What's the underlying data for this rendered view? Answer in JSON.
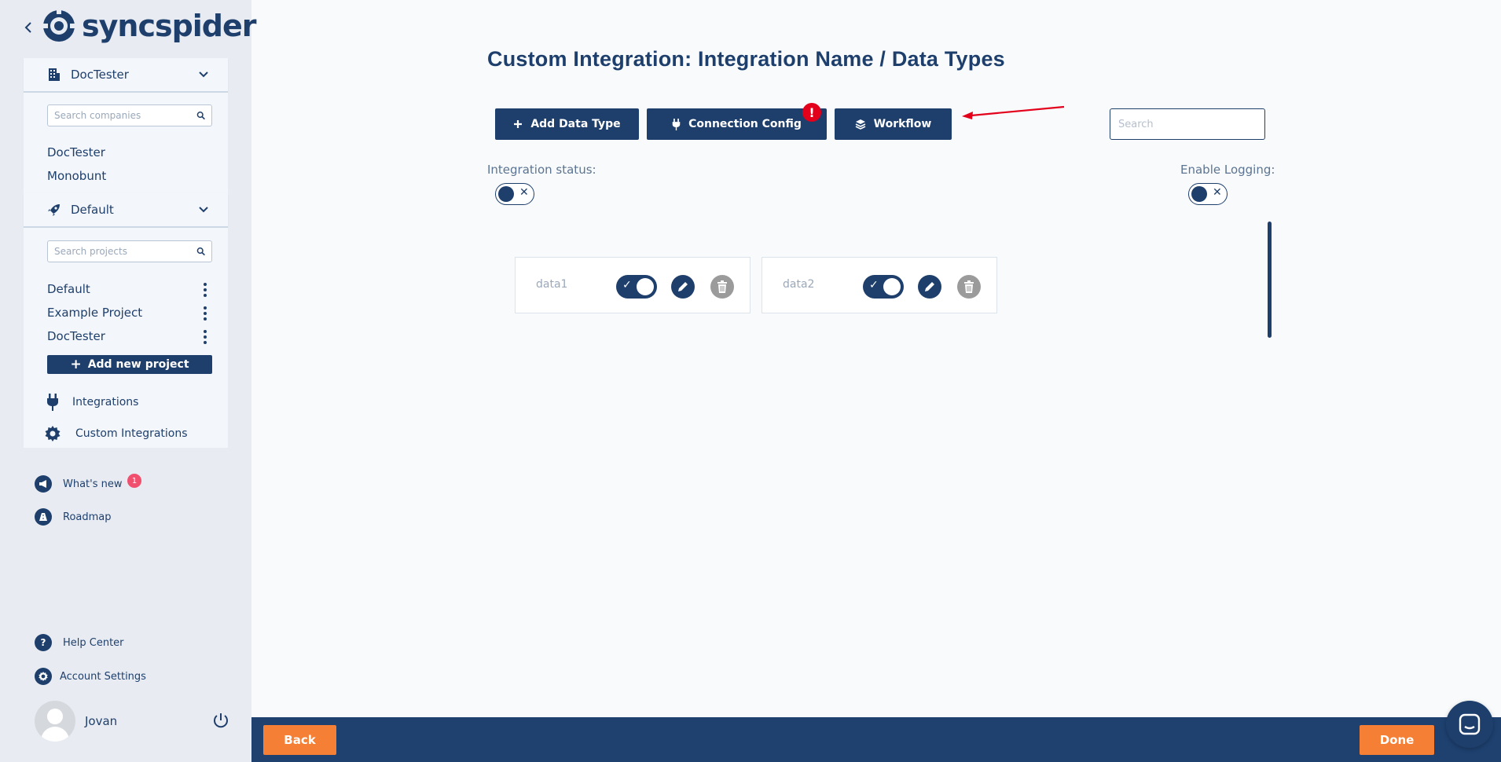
{
  "brand": {
    "name": "syncspider"
  },
  "sidebar": {
    "company_section": {
      "title": "DocTester",
      "search_placeholder": "Search companies",
      "items": [
        "DocTester",
        "Monobunt"
      ]
    },
    "project_section": {
      "title": "Default",
      "search_placeholder": "Search projects",
      "items": [
        "Default",
        "Example Project",
        "DocTester"
      ],
      "add_label": "Add new project"
    },
    "nav": [
      {
        "label": "Integrations",
        "icon": "plug-icon"
      },
      {
        "label": "Custom Integrations",
        "icon": "gear-icon"
      }
    ],
    "extras": [
      {
        "label": "What's new",
        "icon": "megaphone-icon",
        "badge": "1"
      },
      {
        "label": "Roadmap",
        "icon": "road-icon"
      }
    ],
    "bottom": [
      {
        "label": "Help Center",
        "icon": "question-icon"
      },
      {
        "label": "Account Settings",
        "icon": "settings-icon"
      }
    ],
    "user": {
      "name": "Jovan"
    }
  },
  "main": {
    "title": "Custom Integration: Integration Name / Data Types",
    "buttons": {
      "add_data_type": "Add Data Type",
      "connection_config": "Connection Config",
      "connection_alert": "!",
      "workflow": "Workflow"
    },
    "search_placeholder": "Search",
    "integration_status_label": "Integration status:",
    "enable_logging_label": "Enable Logging:",
    "data_types": [
      {
        "name": "data1",
        "enabled": true
      },
      {
        "name": "data2",
        "enabled": true
      }
    ]
  },
  "footer": {
    "back_label": "Back",
    "done_label": "Done"
  },
  "colors": {
    "primary": "#1e3f6c",
    "accent": "#f47f35",
    "alert": "#e3001b",
    "badge": "#f0506e"
  }
}
